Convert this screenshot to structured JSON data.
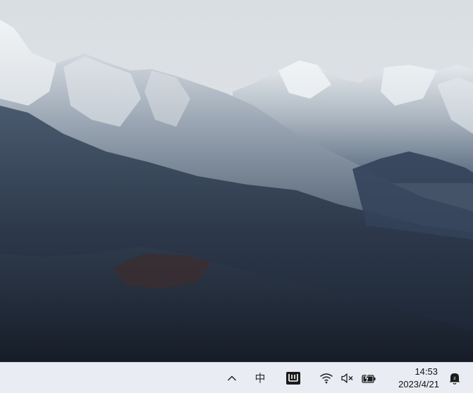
{
  "desktop": {
    "wallpaper": "snow-capped-mountain-range-icon"
  },
  "taskbar": {
    "background": "#e9edf3",
    "tray": {
      "overflow_icon": "chevron-up-icon",
      "ime_mode_label": "中",
      "app_icon": "ime-pad-icon",
      "network_icon": "wifi-icon",
      "volume_icon": "volume-muted-icon",
      "battery_icon": "battery-charging-icon",
      "notification_icon": "notification-bell-icon"
    },
    "clock": {
      "time": "14:53",
      "date": "2023/4/21"
    }
  }
}
